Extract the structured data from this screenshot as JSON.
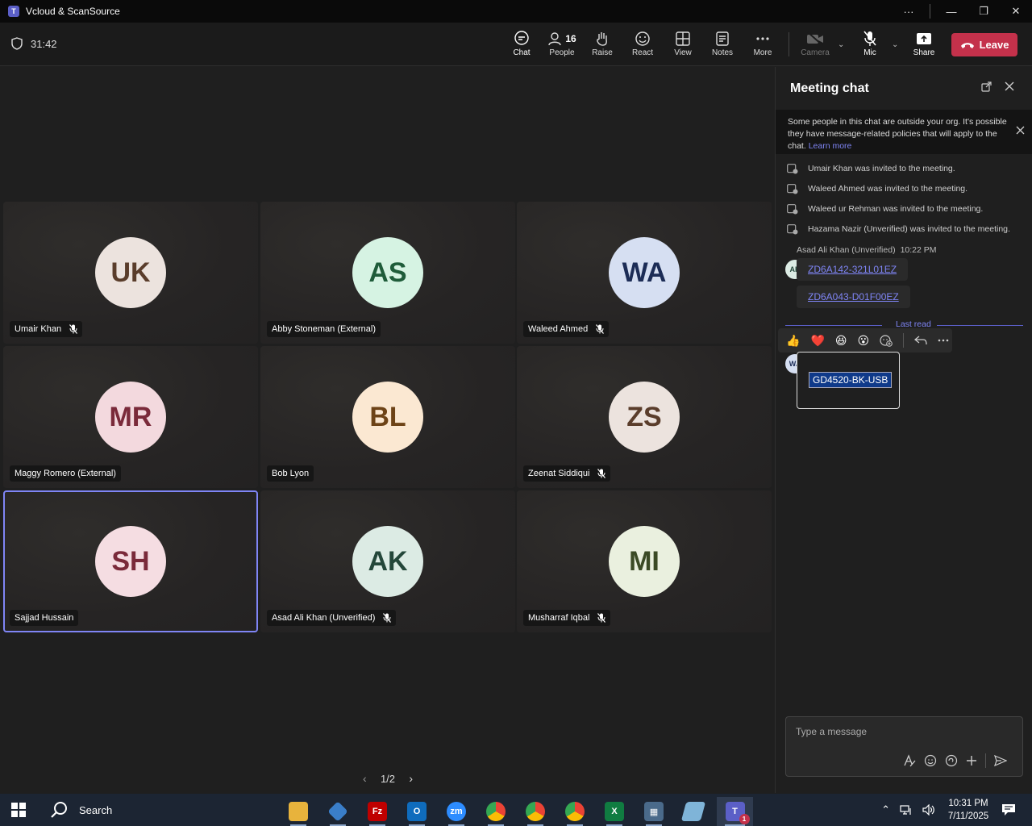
{
  "window": {
    "title": "Vcloud & ScanSource",
    "more": "···",
    "minimize": "—",
    "maximize": "❐",
    "close": "✕"
  },
  "toolbar": {
    "timer": "31:42",
    "people_count": "16",
    "buttons": {
      "chat": "Chat",
      "people": "People",
      "raise": "Raise",
      "react": "React",
      "view": "View",
      "notes": "Notes",
      "more": "More",
      "camera": "Camera",
      "mic": "Mic",
      "share": "Share"
    },
    "leave": "Leave"
  },
  "tiles": [
    {
      "initials": "UK",
      "name": "Umair Khan",
      "bg": "#ece3de",
      "fg": "#5a3d2b",
      "muted": true
    },
    {
      "initials": "AS",
      "name": "Abby Stoneman (External)",
      "bg": "#d6f3e3",
      "fg": "#1f5c3a",
      "muted": false
    },
    {
      "initials": "WA",
      "name": "Waleed Ahmed",
      "bg": "#d6dff2",
      "fg": "#1c2c56",
      "muted": true
    },
    {
      "initials": "MR",
      "name": "Maggy Romero (External)",
      "bg": "#f3d9de",
      "fg": "#7a2a3a",
      "muted": false
    },
    {
      "initials": "BL",
      "name": "Bob Lyon",
      "bg": "#fbe8d2",
      "fg": "#6d4317",
      "muted": false
    },
    {
      "initials": "ZS",
      "name": "Zeenat Siddiqui",
      "bg": "#ece3de",
      "fg": "#5a3d2b",
      "muted": true
    },
    {
      "initials": "SH",
      "name": "Sajjad Hussain",
      "bg": "#f5dde2",
      "fg": "#7a2a3a",
      "muted": false
    },
    {
      "initials": "AK",
      "name": "Asad Ali Khan (Unverified)",
      "bg": "#dcebe4",
      "fg": "#24473a",
      "muted": true
    },
    {
      "initials": "MI",
      "name": "Musharraf Iqbal",
      "bg": "#eaf0df",
      "fg": "#3b4a25",
      "muted": true
    }
  ],
  "pager": {
    "text": "1/2",
    "prev": "‹",
    "next": "›"
  },
  "chat": {
    "title": "Meeting chat",
    "banner": "Some people in this chat are outside your org. It's possible they have message-related policies that will apply to the chat.",
    "banner_link": "Learn more",
    "system_messages": [
      "Umair Khan was invited to the meeting.",
      "Waleed Ahmed was invited to the meeting.",
      "Waleed ur Rehman was invited to the meeting.",
      "Hazama Nazir (Unverified) was invited to the meeting."
    ],
    "sender_name": "Asad Ali Khan (Unverified)",
    "sender_time": "10:22 PM",
    "sender_initials": "AK",
    "messages": [
      "ZD6A142-321L01EZ",
      "ZD6A043-D01F00EZ"
    ],
    "last_read": "Last read",
    "reactions": [
      "👍",
      "❤️",
      "😆",
      "😮"
    ],
    "reply_initials": "WA",
    "selected_message": "GD4520-BK-USB",
    "compose_placeholder": "Type a message"
  },
  "taskbar": {
    "search": "Search",
    "time": "10:31 PM",
    "date": "7/11/2025",
    "teams_badge": "1"
  }
}
